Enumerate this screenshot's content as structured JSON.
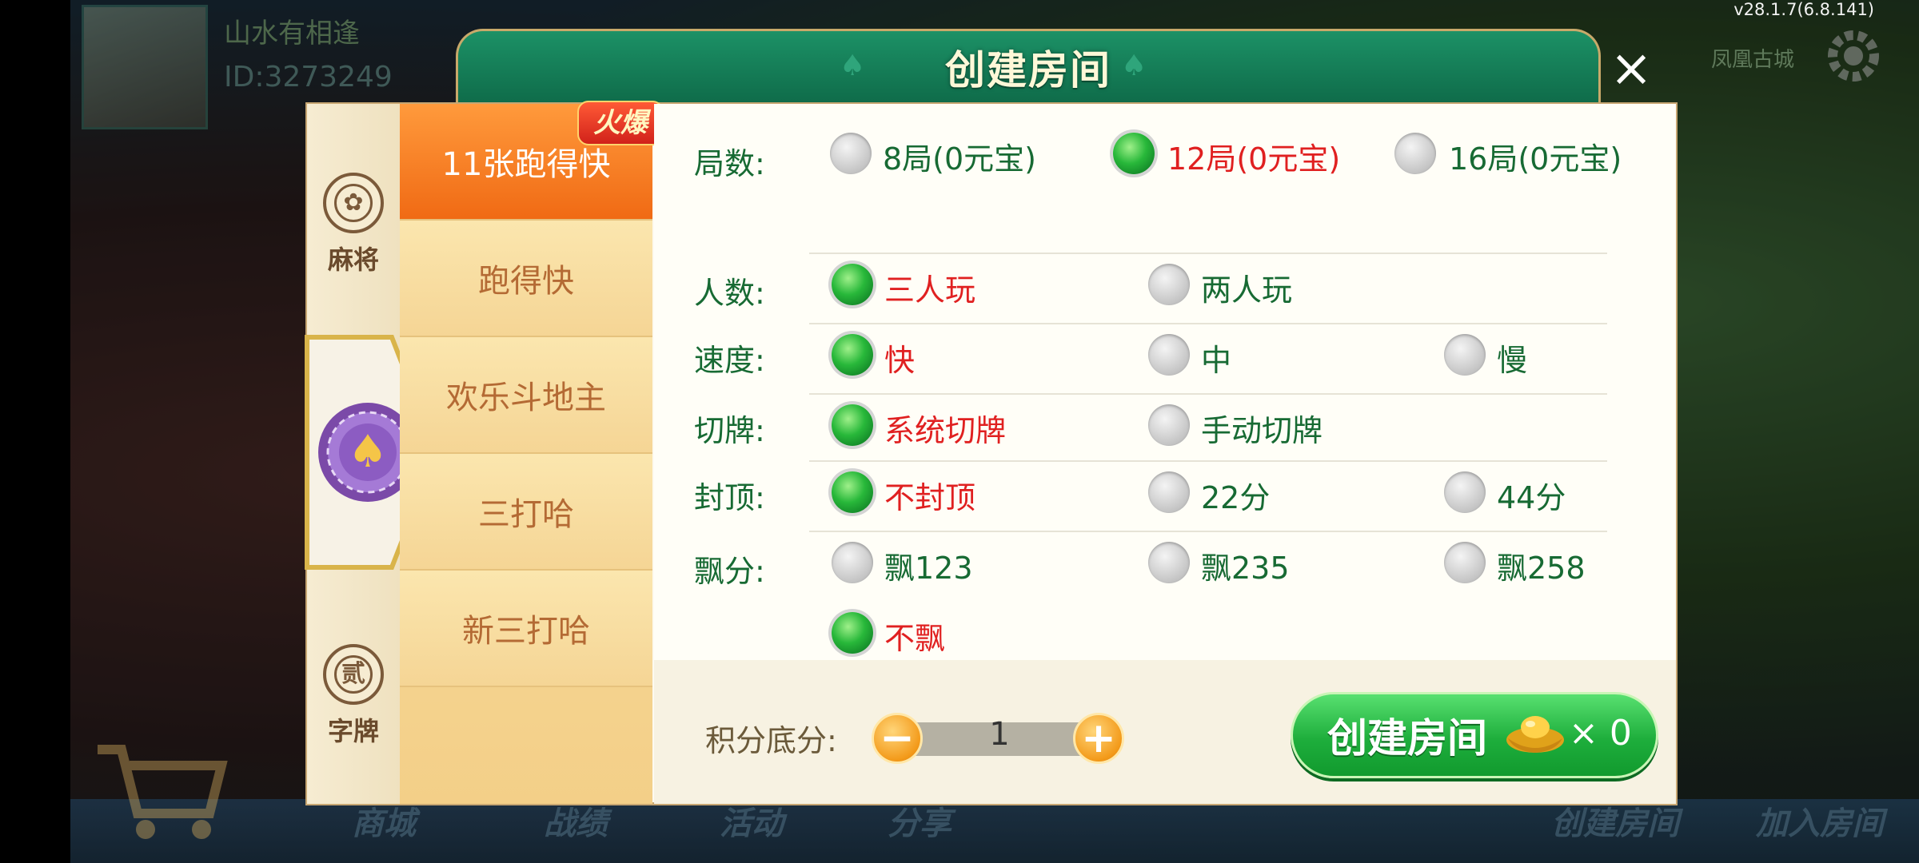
{
  "background": {
    "profile_name": "山水有相逢",
    "profile_id": "ID:3273249",
    "version": "v28.1.7(6.8.141)",
    "city_label": "凤凰古城",
    "bottom_items": [
      "商城",
      "战绩",
      "活动",
      "分享",
      "创建房间",
      "加入房间"
    ]
  },
  "dialog": {
    "title": "创建房间",
    "close_symbol": "×"
  },
  "categories": [
    {
      "label": "麻将",
      "icon": "mahjong-flower-icon",
      "glyph": "✿"
    },
    {
      "label": "",
      "icon": "poker-spade-icon",
      "glyph": "♠"
    },
    {
      "label": "字牌",
      "icon": "zipai-tile-icon",
      "glyph": "贰"
    }
  ],
  "games": [
    {
      "label": "11张跑得快",
      "selected": true
    },
    {
      "label": "跑得快",
      "selected": false
    },
    {
      "label": "欢乐斗地主",
      "selected": false
    },
    {
      "label": "三打哈",
      "selected": false
    },
    {
      "label": "新三打哈",
      "selected": false
    }
  ],
  "hot_badge": "火爆",
  "options": {
    "rounds": {
      "label": "局数:",
      "choices": [
        "8局(0元宝)",
        "12局(0元宝)",
        "16局(0元宝)"
      ],
      "selected": 1
    },
    "players": {
      "label": "人数:",
      "choices": [
        "三人玩",
        "两人玩"
      ],
      "selected": 0
    },
    "speed": {
      "label": "速度:",
      "choices": [
        "快",
        "中",
        "慢"
      ],
      "selected": 0
    },
    "cut": {
      "label": "切牌:",
      "choices": [
        "系统切牌",
        "手动切牌"
      ],
      "selected": 0
    },
    "cap": {
      "label": "封顶:",
      "choices": [
        "不封顶",
        "22分",
        "44分"
      ],
      "selected": 0
    },
    "float": {
      "label": "飘分:",
      "choices": [
        "飘123",
        "飘235",
        "飘258",
        "不飘"
      ],
      "selected": 3
    }
  },
  "footer": {
    "score_label": "积分底分:",
    "score_value": "1",
    "minus": "−",
    "plus": "+",
    "create_label": "创建房间",
    "cost": "× 0"
  },
  "colors": {
    "selected_text": "#e02020",
    "normal_text": "#176a33",
    "header_green": "#0f6c4a",
    "accent_orange": "#f06a14"
  }
}
